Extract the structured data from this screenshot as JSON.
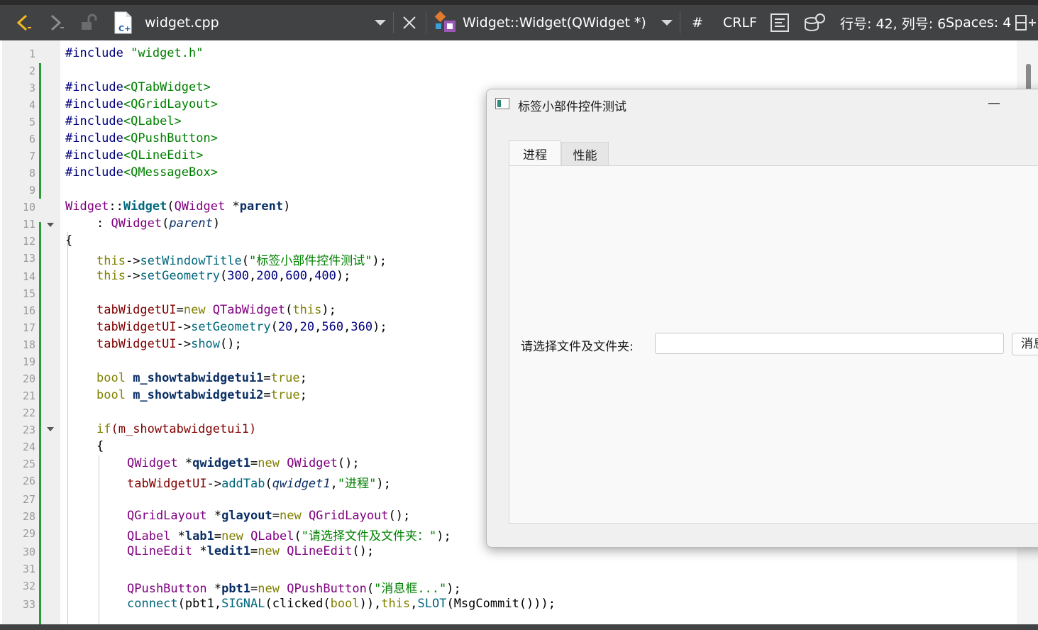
{
  "toolbar": {
    "filename": "widget.cpp",
    "symbol": "Widget::Widget(QWidget *)",
    "hash": "#",
    "line_ending": "CRLF",
    "position": "行号: 42, 列号: 6",
    "spaces": "Spaces: 4"
  },
  "lines": [
    "1",
    "2",
    "3",
    "4",
    "5",
    "6",
    "7",
    "8",
    "9",
    "10",
    "11",
    "12",
    "13",
    "14",
    "15",
    "16",
    "17",
    "18",
    "19",
    "20",
    "21",
    "22",
    "23",
    "24",
    "25",
    "26",
    "27",
    "28",
    "29",
    "30",
    "31",
    "32",
    "33"
  ],
  "code": {
    "l1": [
      "#include ",
      "\"widget.h\""
    ],
    "l3": [
      "#include",
      "<QTabWidget>"
    ],
    "l4": [
      "#include",
      "<QGridLayout>"
    ],
    "l5": [
      "#include",
      "<QLabel>"
    ],
    "l6": [
      "#include",
      "<QPushButton>"
    ],
    "l7": [
      "#include",
      "<QLineEdit>"
    ],
    "l8": [
      "#include",
      "<QMessageBox>"
    ],
    "l10": [
      "Widget",
      "::",
      "Widget",
      "(",
      "QWidget",
      " *",
      "parent",
      ")"
    ],
    "l11": [
      ": ",
      "QWidget",
      "(",
      "parent",
      ")"
    ],
    "l12": "{",
    "l13": [
      "this",
      "->",
      "setWindowTitle",
      "(",
      "\"标签小部件控件测试\"",
      ");"
    ],
    "l14": [
      "this",
      "->",
      "setGeometry",
      "(",
      "300",
      ",",
      "200",
      ",",
      "600",
      ",",
      "400",
      ");"
    ],
    "l16": [
      "tabWidgetUI",
      "=",
      "new ",
      "QTabWidget",
      "(",
      "this",
      ");"
    ],
    "l17": [
      "tabWidgetUI",
      "->",
      "setGeometry",
      "(",
      "20",
      ",",
      "20",
      ",",
      "560",
      ",",
      "360",
      ");"
    ],
    "l18": [
      "tabWidgetUI",
      "->",
      "show",
      "();"
    ],
    "l20": [
      "bool ",
      "m_showtabwidgetui1",
      "=",
      "true",
      ";"
    ],
    "l21": [
      "bool ",
      "m_showtabwidgetui2",
      "=",
      "true",
      ";"
    ],
    "l23": [
      "if",
      "(m_showtabwidgetui1)"
    ],
    "l24": "{",
    "l25": [
      "QWidget",
      " *",
      "qwidget1",
      "=",
      "new ",
      "QWidget",
      "();"
    ],
    "l26": [
      "tabWidgetUI",
      "->",
      "addTab",
      "(",
      "qwidget1",
      ",",
      "\"进程\"",
      ");"
    ],
    "l28": [
      "QGridLayout",
      " *",
      "glayout",
      "=",
      "new ",
      "QGridLayout",
      "();"
    ],
    "l29": [
      "QLabel",
      " *",
      "lab1",
      "=",
      "new ",
      "QLabel",
      "(",
      "\"请选择文件及文件夹：\"",
      ");"
    ],
    "l30": [
      "QLineEdit",
      " *",
      "ledit1",
      "=",
      "new ",
      "QLineEdit",
      "();"
    ],
    "l32": [
      "QPushButton",
      " *",
      "pbt1",
      "=",
      "new ",
      "QPushButton",
      "(",
      "\"消息框...\"",
      ");"
    ],
    "l33": [
      "connect",
      "(pbt1,",
      "SIGNAL",
      "(clicked(",
      "bool",
      ")),",
      "this",
      ",",
      "SLOT",
      "(MsgCommit()));"
    ]
  },
  "app_window": {
    "title": "标签小部件控件测试",
    "min_glyph": "—",
    "tabs": [
      "进程",
      "性能"
    ],
    "label": "请选择文件及文件夹:",
    "lineedit_value": "",
    "button_label": "消息框..."
  },
  "colors": {
    "toolbar_bg": "#404244",
    "keyword": "#808000",
    "string": "#008000",
    "type": "#800080",
    "function": "#00677c",
    "number": "#000080",
    "change_bar": "#2c9b3a"
  }
}
